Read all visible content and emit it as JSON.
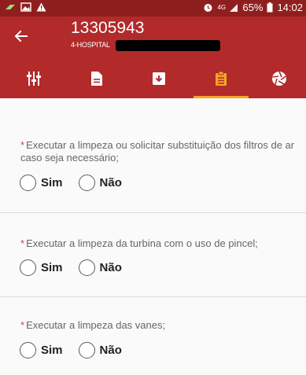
{
  "status_bar": {
    "network": "4G",
    "battery_percent": "65%",
    "time": "14:02"
  },
  "header": {
    "title": "13305943",
    "subtitle": "4-HOSPITAL"
  },
  "tabs": [
    {
      "icon": "sliders-icon",
      "active": false
    },
    {
      "icon": "document-icon",
      "active": false
    },
    {
      "icon": "archive-icon",
      "active": false
    },
    {
      "icon": "clipboard-icon",
      "active": true
    },
    {
      "icon": "aperture-icon",
      "active": false
    }
  ],
  "colors": {
    "status_bar": "#8f1f1f",
    "app_bar": "#b22a2a",
    "active_tab": "#f5a524",
    "required_mark": "#e23a3a"
  },
  "questions": [
    {
      "required_mark": "*",
      "text": "Executar a limpeza ou solicitar substituição dos filtros de ar caso seja necessário;",
      "options": [
        "Sim",
        "Não"
      ]
    },
    {
      "required_mark": "*",
      "text": "Executar a limpeza da turbina com o uso de pincel;",
      "options": [
        "Sim",
        "Não"
      ]
    },
    {
      "required_mark": "*",
      "text": "Executar a limpeza das vanes;",
      "options": [
        "Sim",
        "Não"
      ]
    }
  ]
}
